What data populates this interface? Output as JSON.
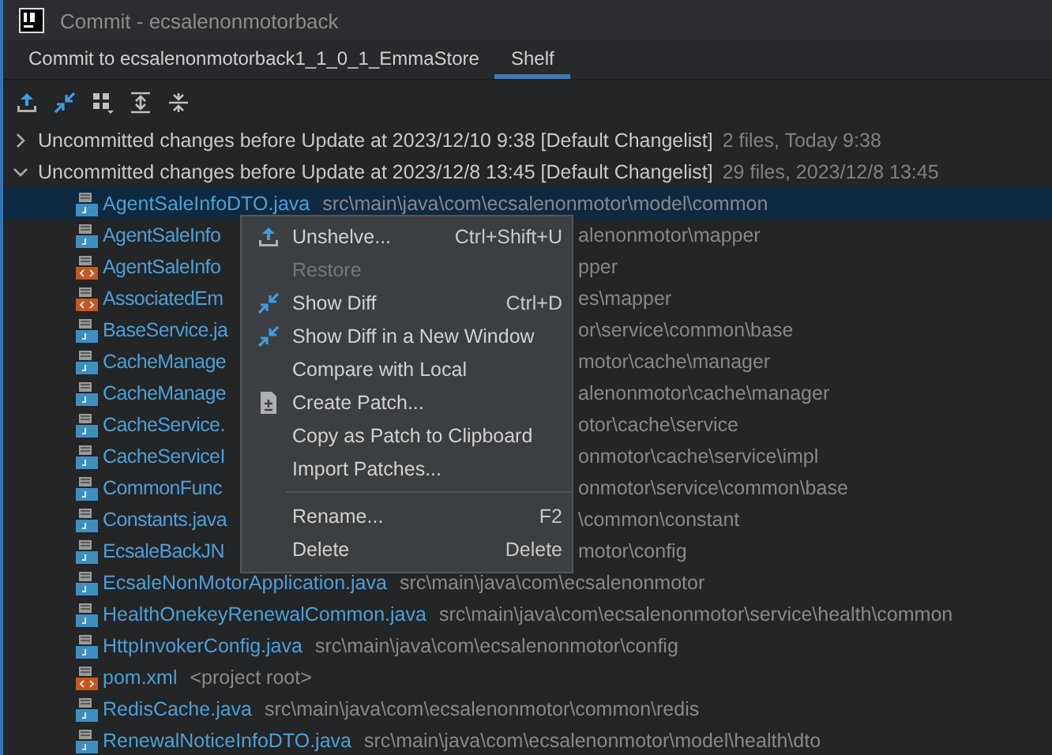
{
  "window": {
    "title": "Commit - ecsalenonmotorback"
  },
  "tabs": [
    {
      "label": "Commit to ecsalenonmotorback1_1_0_1_EmmaStore",
      "selected": false
    },
    {
      "label": "Shelf",
      "selected": true
    }
  ],
  "changelists": [
    {
      "label": "Uncommitted changes before Update at 2023/12/10 9:38 [Default Changelist]",
      "info": "2 files, Today 9:38",
      "expanded": false
    },
    {
      "label": "Uncommitted changes before Update at 2023/12/8 13:45 [Default Changelist]",
      "info": "29 files, 2023/12/8 13:45",
      "expanded": true,
      "files": [
        {
          "kind": "java",
          "name": "AgentSaleInfoDTO.java",
          "path": "src\\main\\java\\com\\ecsalenonmotor\\model\\common",
          "selected": true,
          "behind_menu": false
        },
        {
          "kind": "java",
          "name": "AgentSaleInfo",
          "path": "alenonmotor\\mapper",
          "selected": false,
          "behind_menu": true
        },
        {
          "kind": "xml",
          "name": "AgentSaleInfo",
          "path": "pper",
          "selected": false,
          "behind_menu": true
        },
        {
          "kind": "xml",
          "name": "AssociatedEm",
          "path": "es\\mapper",
          "selected": false,
          "behind_menu": true
        },
        {
          "kind": "java",
          "name": "BaseService.ja",
          "path": "or\\service\\common\\base",
          "selected": false,
          "behind_menu": true
        },
        {
          "kind": "java",
          "name": "CacheManage",
          "path": "motor\\cache\\manager",
          "selected": false,
          "behind_menu": true
        },
        {
          "kind": "java",
          "name": "CacheManage",
          "path": "alenonmotor\\cache\\manager",
          "selected": false,
          "behind_menu": true
        },
        {
          "kind": "java",
          "name": "CacheService.",
          "path": "otor\\cache\\service",
          "selected": false,
          "behind_menu": true
        },
        {
          "kind": "java",
          "name": "CacheServiceI",
          "path": "onmotor\\cache\\service\\impl",
          "selected": false,
          "behind_menu": true
        },
        {
          "kind": "java",
          "name": "CommonFunc",
          "path": "onmotor\\service\\common\\base",
          "selected": false,
          "behind_menu": true
        },
        {
          "kind": "java",
          "name": "Constants.java",
          "path": "\\common\\constant",
          "selected": false,
          "behind_menu": true
        },
        {
          "kind": "java",
          "name": "EcsaleBackJN",
          "path": "motor\\config",
          "selected": false,
          "behind_menu": true
        },
        {
          "kind": "java",
          "name": "EcsaleNonMotorApplication.java",
          "path": "src\\main\\java\\com\\ecsalenonmotor",
          "selected": false,
          "behind_menu": false
        },
        {
          "kind": "java",
          "name": "HealthOnekeyRenewalCommon.java",
          "path": "src\\main\\java\\com\\ecsalenonmotor\\service\\health\\common",
          "selected": false,
          "behind_menu": false
        },
        {
          "kind": "java",
          "name": "HttpInvokerConfig.java",
          "path": "src\\main\\java\\com\\ecsalenonmotor\\config",
          "selected": false,
          "behind_menu": false
        },
        {
          "kind": "xml",
          "name": "pom.xml",
          "path": "<project root>",
          "selected": false,
          "behind_menu": false
        },
        {
          "kind": "java",
          "name": "RedisCache.java",
          "path": "src\\main\\java\\com\\ecsalenonmotor\\common\\redis",
          "selected": false,
          "behind_menu": false
        },
        {
          "kind": "java",
          "name": "RenewalNoticeInfoDTO.java",
          "path": "src\\main\\java\\com\\ecsalenonmotor\\model\\health\\dto",
          "selected": false,
          "behind_menu": false
        }
      ]
    }
  ],
  "context_menu": [
    {
      "kind": "unshelve",
      "label": "Unshelve...",
      "shortcut": "Ctrl+Shift+U",
      "disabled": false
    },
    {
      "kind": "plain",
      "label": "Restore",
      "disabled": true
    },
    {
      "kind": "diff",
      "label": "Show Diff",
      "shortcut": "Ctrl+D",
      "disabled": false
    },
    {
      "kind": "diff",
      "label": "Show Diff in a New Window",
      "disabled": false
    },
    {
      "kind": "plain",
      "label": "Compare with Local",
      "disabled": false
    },
    {
      "kind": "patch",
      "label": "Create Patch...",
      "disabled": false
    },
    {
      "kind": "plain",
      "label": "Copy as Patch to Clipboard",
      "disabled": false
    },
    {
      "kind": "plain",
      "label": "Import Patches...",
      "disabled": false
    },
    {
      "kind": "separator"
    },
    {
      "kind": "plain",
      "label": "Rename...",
      "shortcut": "F2",
      "disabled": false
    },
    {
      "kind": "plain",
      "label": "Delete",
      "shortcut": "Delete",
      "disabled": false
    }
  ]
}
